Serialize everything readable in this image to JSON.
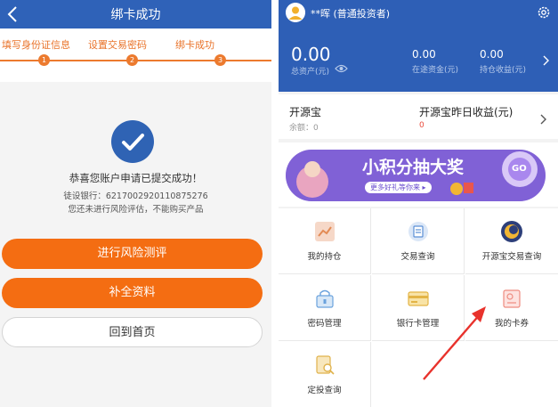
{
  "left_screen": {
    "header": {
      "title": "绑卡成功"
    },
    "steps": [
      {
        "label": "填写身份证信息",
        "number": "1"
      },
      {
        "label": "设置交易密码",
        "number": "2"
      },
      {
        "label": "绑卡成功",
        "number": "3"
      }
    ],
    "success": {
      "title": "恭喜您账户申请已提交成功！",
      "bank_line": "徒设银行：6217002920110875276",
      "notice": "您还未进行风险评估，不能购买产品"
    },
    "buttons": {
      "risk_test": "进行风险测评",
      "complete_info": "补全资料",
      "home": "回到首页"
    },
    "colors": {
      "accent": "#f46d12",
      "brand": "#2f62b8"
    }
  },
  "right_screen": {
    "user": {
      "name": "**晖 (普通投资者)"
    },
    "assets": {
      "total_value": "0.00",
      "total_label": "总资产(元)",
      "in_transit_value": "0.00",
      "in_transit_label": "在途资金(元)",
      "holding_income_value": "0.00",
      "holding_income_label": "持仓收益(元)"
    },
    "kaiyuanbao": {
      "title": "开源宝",
      "balance": "余额：0",
      "yesterday_title": "开源宝昨日收益(元)",
      "yesterday_value": "0"
    },
    "banner": {
      "title": "小积分抽大奖",
      "subtitle": "更多好礼等你来 ▸",
      "go": "GO"
    },
    "menu": [
      {
        "label": "我的持仓",
        "icon": "chart-icon"
      },
      {
        "label": "交易查询",
        "icon": "document-refresh-icon"
      },
      {
        "label": "开源宝交易查询",
        "icon": "kaiyuan-logo-icon"
      },
      {
        "label": "密码管理",
        "icon": "lock-icon"
      },
      {
        "label": "银行卡管理",
        "icon": "bank-card-icon"
      },
      {
        "label": "我的卡券",
        "icon": "coupon-icon"
      },
      {
        "label": "定投查询",
        "icon": "search-document-icon"
      }
    ]
  }
}
